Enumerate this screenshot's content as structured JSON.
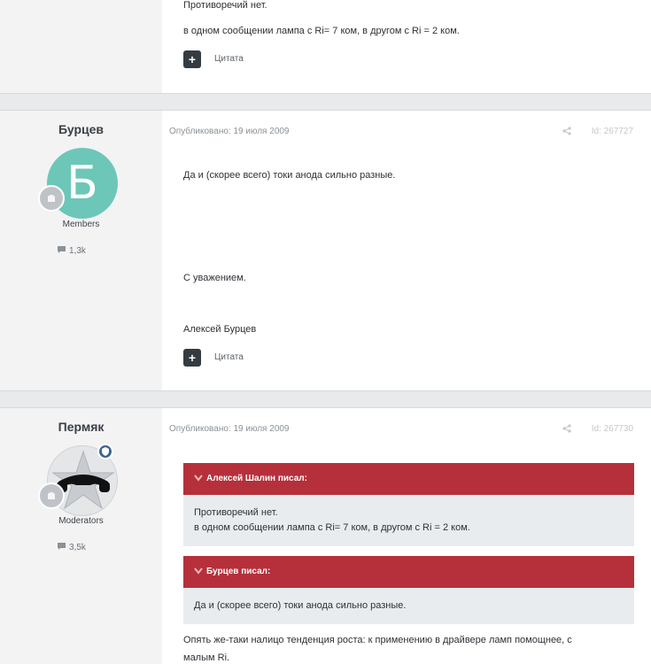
{
  "post1": {
    "lines": [
      "Противоречий нет.",
      "в одном сообщении лампа с Ri= 7 ком, в другом с Ri = 2 ком."
    ],
    "quote_label": "Цитата",
    "quote_icon": "+"
  },
  "post2": {
    "author": "Бурцев",
    "avatar_letter": "Б",
    "group": "Members",
    "post_count": "1,3k",
    "published": "Опубликовано: 19 июля 2009",
    "post_id": "Id: 267727",
    "lines": [
      "Да и (скорее всего) токи анода сильно разные.",
      "С уважением.",
      "Алексей Бурцев"
    ],
    "quote_label": "Цитата",
    "quote_icon": "+"
  },
  "post3": {
    "author": "Пермяк",
    "group": "Moderators",
    "post_count": "3,5k",
    "published": "Опубликовано: 19 июля 2009",
    "post_id": "Id: 267730",
    "quotes": [
      {
        "header": "Алексей Шалин писал:",
        "lines": [
          "Противоречий нет.",
          "в одном сообщении лампа с Ri= 7 ком, в другом с Ri = 2 ком."
        ]
      },
      {
        "header": "Бурцев писал:",
        "lines": [
          "Да и (скорее всего) токи анода сильно разные."
        ]
      }
    ],
    "text_lines": [
      "Опять же-таки налицо тенденция роста: к применению в драйвере ламп помощнее, с",
      "малым Ri."
    ]
  },
  "colors": {
    "accent": "#b5303a",
    "avatar_bg": "#6cc7b8",
    "moderator_badge": "#3d6594"
  }
}
